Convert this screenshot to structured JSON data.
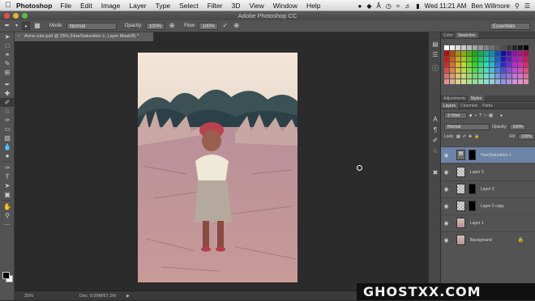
{
  "menubar": {
    "app_name": "Photoshop",
    "items": [
      "File",
      "Edit",
      "Image",
      "Layer",
      "Type",
      "Select",
      "Filter",
      "3D",
      "View",
      "Window",
      "Help"
    ],
    "clock": "Wed 11:21 AM",
    "user": "Ben Willmore"
  },
  "window": {
    "title": "Adobe Photoshop CC"
  },
  "options": {
    "mode_label": "Mode:",
    "mode_value": "Normal",
    "opacity_label": "Opacity:",
    "opacity_value": "100%",
    "flow_label": "Flow:",
    "flow_value": "100%",
    "workspace": "Essentials"
  },
  "document": {
    "tab_title": "Anna cute.psd @ 25% (Hue/Saturation 1, Layer Mask/8) *",
    "zoom": "25%",
    "doc_info": "Doc: 9.00M/67.2M"
  },
  "panels": {
    "color_tabs": [
      "Color",
      "Swatches"
    ],
    "adj_tabs": [
      "Adjustments",
      "Styles"
    ],
    "layer_tabs": [
      "Layers",
      "Channels",
      "Paths"
    ],
    "kind_label": "Kind",
    "blend_mode": "Normal",
    "opacity_label": "Opacity:",
    "opacity_value": "100%",
    "lock_label": "Lock:",
    "fill_label": "Fill:",
    "fill_value": "100%"
  },
  "layers": [
    {
      "name": "Hue/Saturation 1",
      "selected": true,
      "locked": false
    },
    {
      "name": "Layer 3",
      "selected": false,
      "locked": false
    },
    {
      "name": "Layer 2",
      "selected": false,
      "locked": false
    },
    {
      "name": "Layer 2 copy",
      "selected": false,
      "locked": false
    },
    {
      "name": "Layer 1",
      "selected": false,
      "locked": false
    },
    {
      "name": "Background",
      "selected": false,
      "locked": true
    }
  ],
  "watermark": "GHOSTXX.COM"
}
